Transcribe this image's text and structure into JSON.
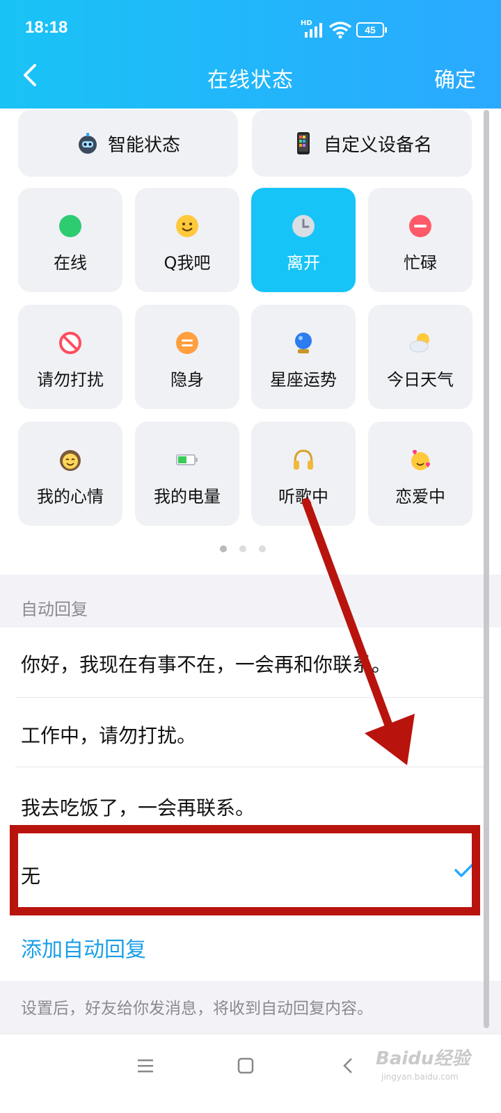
{
  "status_bar": {
    "time": "18:18",
    "hd": "HD",
    "battery": "45"
  },
  "header": {
    "title": "在线状态",
    "confirm": "确定"
  },
  "top_buttons": [
    {
      "label": "智能状态",
      "icon": "robot-icon"
    },
    {
      "label": "自定义设备名",
      "icon": "phone-icon"
    }
  ],
  "status_tiles": [
    {
      "label": "在线",
      "icon": "green-dot-icon"
    },
    {
      "label": "Q我吧",
      "icon": "smile-face-icon"
    },
    {
      "label": "离开",
      "icon": "clock-icon",
      "selected": true
    },
    {
      "label": "忙碌",
      "icon": "minus-circle-icon"
    },
    {
      "label": "请勿打扰",
      "icon": "no-entry-icon"
    },
    {
      "label": "隐身",
      "icon": "invisible-icon"
    },
    {
      "label": "星座运势",
      "icon": "crystal-ball-icon"
    },
    {
      "label": "今日天气",
      "icon": "weather-icon"
    },
    {
      "label": "我的心情",
      "icon": "mood-face-icon"
    },
    {
      "label": "我的电量",
      "icon": "battery-icon"
    },
    {
      "label": "听歌中",
      "icon": "headphones-icon"
    },
    {
      "label": "恋爱中",
      "icon": "love-face-icon"
    }
  ],
  "pager": {
    "pages": 3,
    "current": 1
  },
  "auto_reply": {
    "section_label": "自动回复",
    "options": [
      "你好，我现在有事不在，一会再和你联系。",
      "工作中，请勿打扰。",
      "我去吃饭了，一会再联系。",
      "无"
    ],
    "selected_index": 3,
    "add_label": "添加自动回复",
    "note": "设置后，好友给你发消息，将收到自动回复内容。"
  },
  "watermark": {
    "brand": "Baidu经验",
    "url": "jingyan.baidu.com"
  },
  "colors": {
    "accent": "#17c4f7",
    "link": "#1a9ee6",
    "annotation": "#b8140d"
  }
}
